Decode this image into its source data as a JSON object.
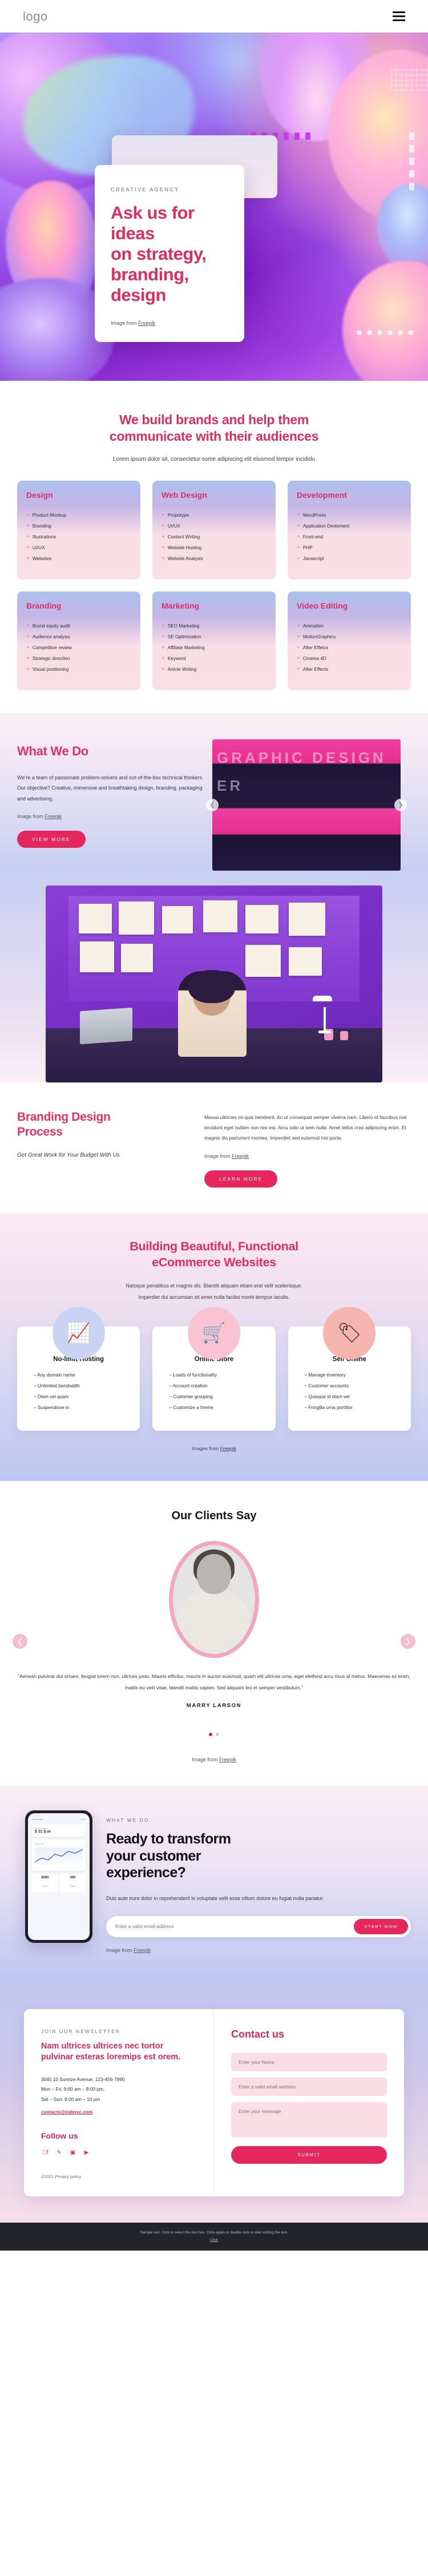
{
  "header": {
    "logo": "logo",
    "menu_icon": "hamburger-icon"
  },
  "hero": {
    "eyebrow": "CREATIVE AGENCY",
    "title_line1": "Ask us for ideas",
    "title_line2": "on strategy,",
    "title_line3": "branding, design",
    "credit_prefix": "Image from ",
    "credit_link": "Freepik"
  },
  "services": {
    "heading_line1": "We build brands and help them",
    "heading_line2": "communicate with their audiences",
    "sub": "Lorem ipsum dolor sit, consectetur some adipiscing elit eiusmod tempor incididu",
    "cards": [
      {
        "title": "Design",
        "items": [
          "Product Mockup",
          "Branding",
          "Illustrations",
          "UI/UX",
          "Websites"
        ]
      },
      {
        "title": "Web Design",
        "items": [
          "Propotype",
          "UI/UX",
          "Content Writing",
          "Website Hosting",
          "Website Analysis"
        ]
      },
      {
        "title": "Development",
        "items": [
          "WordPress",
          "Application Devloment",
          "Front-end",
          "PHP",
          "Javascript"
        ]
      },
      {
        "title": "Branding",
        "items": [
          "Brand equity audit",
          "Audience analysis",
          "Competitive review",
          "Strategic direction",
          "Visual positioning"
        ]
      },
      {
        "title": "Marketing",
        "items": [
          "SEO Marketing",
          "SE Optimization",
          "Affiliate Marketing",
          "Keyword",
          "Article Writing"
        ]
      },
      {
        "title": "Video Editing",
        "items": [
          "Animation",
          "MotionGraphics",
          "After Effetcs",
          "Cinema 4D",
          "After Effects"
        ]
      }
    ]
  },
  "what_we_do": {
    "heading": "What We Do",
    "paragraph": "We’re a team of passionate problem-solvers and out-of-the-box technical thinkers. Our objective? Creative, immersive and breathtaking design, branding, packaging and advertising.",
    "credit_prefix": "Image from ",
    "credit_link": "Freepik",
    "button": "VIEW MORE",
    "slider_prev": "prev-arrow-icon",
    "slider_next": "next-arrow-icon",
    "slide_text": "GRAPHIC DESIGNER"
  },
  "branding": {
    "heading_line1": "Branding Design",
    "heading_line2": "Process",
    "subtitle": "Get Great Work for Your Budget With Us",
    "paragraph": "Massa ultricies mi quis hendrerit. Ac ut consequat semper viverra nam. Libero id faucibus nisl tincidunt eget nullam non nisi est. Arcu odio ut sem nulla. Amet tellus cras adipiscing enim. Et magnis dis parturient montes. Imperdiet sed euismod nisi porta.",
    "credit_prefix": "Image from ",
    "credit_link": "Freepik",
    "button": "LEARN MORE"
  },
  "ecommerce": {
    "heading_line1": "Building Beautiful, Functional",
    "heading_line2": "eCommerce Websites",
    "sub_line1": "Natoque penatibus et magnis dis. Blandit aliquam etiam erat velit scelerisque.",
    "sub_line2": "Imperdiet dui accumsan sit amet nulla facilisi morbi tempus iaculis.",
    "cards": [
      {
        "icon": "growth-chart-icon",
        "title": "No-limit Hosting",
        "items": [
          "– Any domain name",
          "– Unlimited bandwidth",
          "– Diam vel quam",
          "– Suspendisse in"
        ]
      },
      {
        "icon": "shopping-basket-icon",
        "title": "Online Store",
        "items": [
          "– Loads of functionality",
          "– Account creation",
          "– Customer grouping",
          "– Customize a theme"
        ]
      },
      {
        "icon": "discount-tags-icon",
        "title": "Sell Online",
        "items": [
          "– Manage inventory",
          "– Customer accounts",
          "– Quisque id diam vel",
          "– Fringilla urna porttitor"
        ]
      }
    ],
    "credit_prefix": "Images from ",
    "credit_link": "Freepik"
  },
  "testimonials": {
    "heading": "Our Clients Say",
    "quote": "\"Aenean pulvinar dui ornare, feugiat lorem non, ultrices justo. Mauris efficitur, mauris in auctor euismod, quam elit ultrices urna, eget eleifend arcu risus id metus. Maecenas ex enim, mattis eu velit vitae, blandit mattis sapien. Sed aliquam leo et semper vestibulum.\"",
    "author": "MARRY LARSON",
    "prev": "prev-arrow-icon",
    "next": "next-arrow-icon",
    "credit_prefix": "Image from ",
    "credit_link": "Freepik"
  },
  "cta": {
    "eyebrow": "WHAT WE DO",
    "heading_line1": "Ready to transform",
    "heading_line2": "your customer",
    "heading_line3": "experience?",
    "paragraph": "Duis aute irure dolor in reprehenderit in voluptate velit esse cillum dolore eu fugiat nulla pariatur.",
    "email_placeholder": "Enter a valid email address",
    "button": "START NOW",
    "credit_prefix": "Image from ",
    "credit_link": "Freepik",
    "phone": {
      "top_left": "Dashboard",
      "top_right": "9:41",
      "balance_label": "Total balance",
      "balance_value": "$ 31 b.m",
      "chart_label": "Revenue",
      "stat1_value": "3680",
      "stat1_label": "Orders",
      "stat2_value": "465",
      "stat2_label": "Visits"
    }
  },
  "footer": {
    "newsletter_eyebrow": "JOIN OUR NEWSLETTER",
    "newsletter_heading": "Nam ultrices ultrices nec tortor pulvinar esteras loremips est orem.",
    "address": "3045 10 Sunrize Avenue, 123-456-7890",
    "hours_week": "Mon – Fri: 9:00 am – 8:00 pm,",
    "hours_weekend": "Sat – Sun: 9:00 am – 10 pm",
    "email": "contacts@esbnyc.com",
    "follow_heading": "Follow us",
    "socials": [
      "facebook-icon",
      "twitter-icon",
      "instagram-icon",
      "youtube-icon"
    ],
    "copyright": "©2021 Privacy policy",
    "contact_heading": "Contact us",
    "name_placeholder": "Enter your Name",
    "email_placeholder": "Enter a valid email address",
    "message_placeholder": "Enter your message",
    "submit": "SUBMIT"
  },
  "bottom_bar": {
    "line1": "Sample text. Click to select the text box. Click again or double click to start editing the text.",
    "link": "Click"
  }
}
